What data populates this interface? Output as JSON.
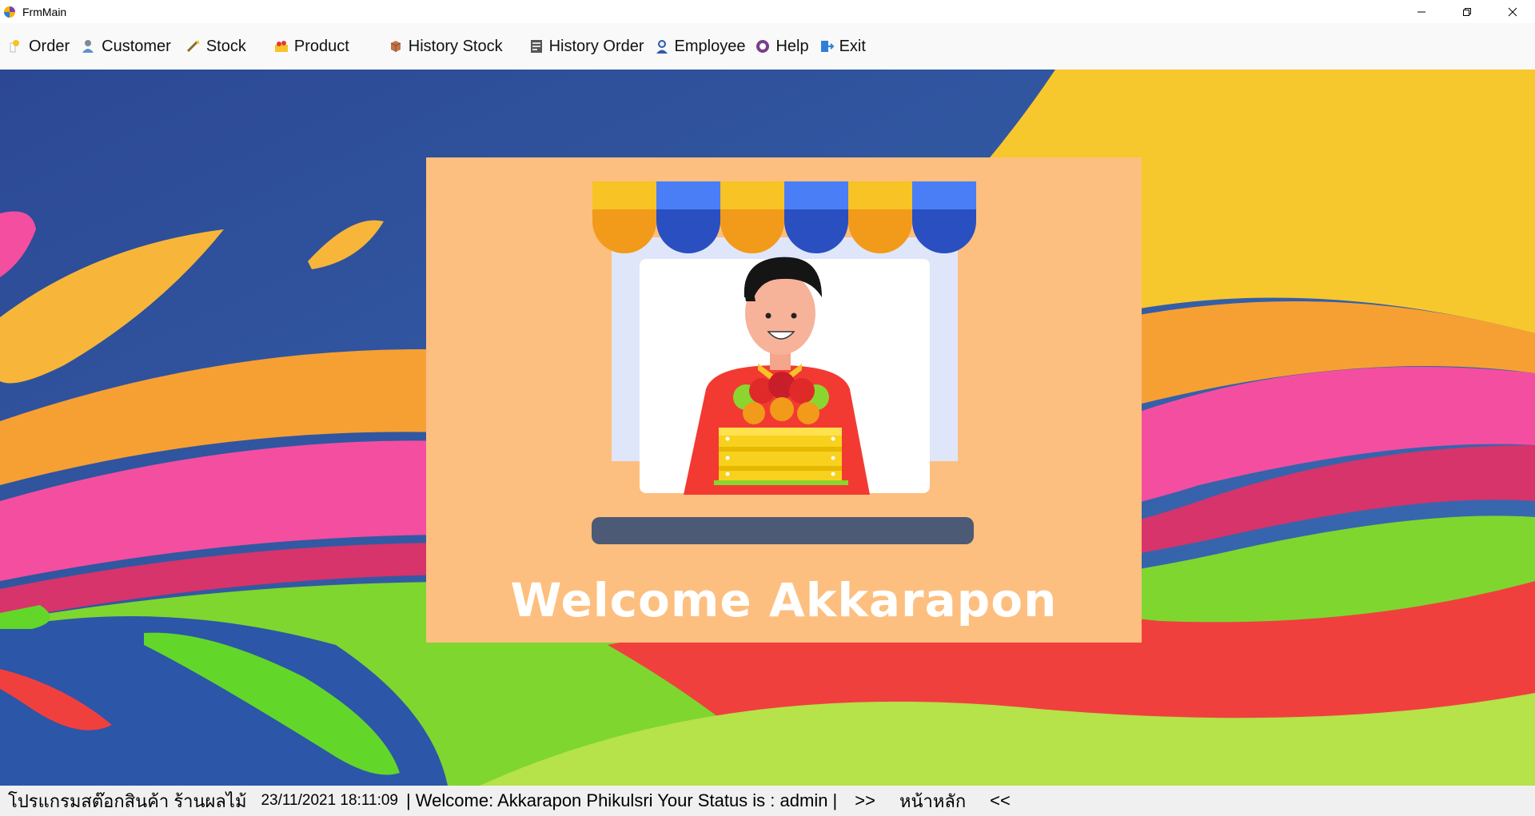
{
  "window": {
    "title": "FrmMain"
  },
  "menu": {
    "items": [
      {
        "label": "Order"
      },
      {
        "label": "Customer"
      },
      {
        "label": "Stock"
      },
      {
        "label": "Product"
      },
      {
        "label": "History Stock"
      },
      {
        "label": "History Order"
      },
      {
        "label": "Employee"
      },
      {
        "label": "Help"
      },
      {
        "label": "Exit"
      }
    ]
  },
  "main": {
    "welcome_text": "Welcome Akkarapon"
  },
  "status": {
    "program_name": "โปรแกรมสต๊อกสินค้า ร้านผลไม้",
    "datetime": "23/11/2021 18:11:09",
    "user_info": "| Welcome: Akkarapon Phikulsri Your Status is : admin |",
    "nav_next": ">>",
    "home_label": "หน้าหลัก",
    "nav_prev": "<<"
  },
  "colors": {
    "menubar_bg": "#f9f9f9",
    "card_bg": "#fdbf7f",
    "awning_yellow": "#f7c325",
    "awning_blue": "#4a7ef7"
  },
  "icons": [
    "app-logo-icon",
    "minimize-icon",
    "restore-icon",
    "close-icon",
    "order-icon",
    "customer-icon",
    "stock-icon",
    "product-icon",
    "history-stock-icon",
    "history-order-icon",
    "employee-icon",
    "help-icon",
    "exit-icon"
  ]
}
